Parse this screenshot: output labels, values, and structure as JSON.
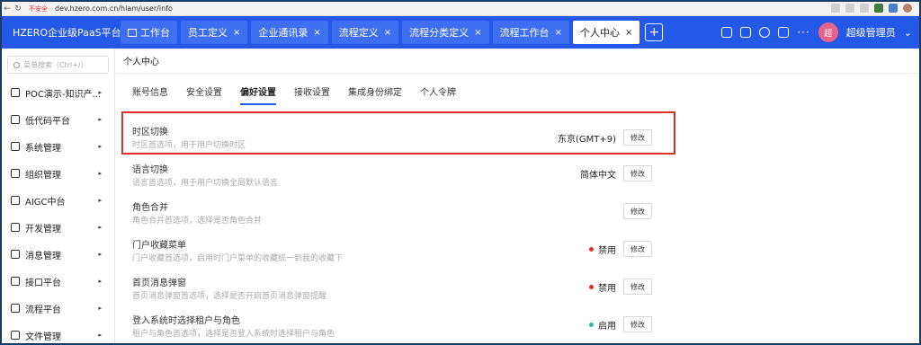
{
  "browser": {
    "secure_label": "不安全",
    "url": "dev.hzero.com.cn/hiam/user/info"
  },
  "app": {
    "brand": "HZERO企业级PaaS平台",
    "tabs": [
      {
        "label": "工作台",
        "closable": false
      },
      {
        "label": "员工定义",
        "closable": true
      },
      {
        "label": "企业通讯录",
        "closable": true
      },
      {
        "label": "流程定义",
        "closable": true
      },
      {
        "label": "流程分类定义",
        "closable": true
      },
      {
        "label": "流程工作台",
        "closable": true
      },
      {
        "label": "个人中心",
        "closable": true,
        "active": true
      }
    ],
    "close_glyph": "×",
    "add_glyph": "+",
    "more_glyph": "···",
    "avatar_text": "超",
    "user_name": "超级管理员",
    "user_chevron": "⌄"
  },
  "sidebar": {
    "search_placeholder": "菜单搜索（Ctrl+/）",
    "items": [
      {
        "label": "POC演示-知识产...",
        "icon": "doc-icon",
        "arrow": "▸"
      },
      {
        "label": "低代码平台",
        "icon": "grid-icon",
        "arrow": "▸"
      },
      {
        "label": "系统管理",
        "icon": "settings-icon",
        "arrow": "▸"
      },
      {
        "label": "组织管理",
        "icon": "org-icon",
        "arrow": "▸"
      },
      {
        "label": "AIGC中台",
        "icon": "ai-icon",
        "arrow": "▸"
      },
      {
        "label": "开发管理",
        "icon": "code-icon",
        "arrow": "▸"
      },
      {
        "label": "消息管理",
        "icon": "message-icon",
        "arrow": "▸"
      },
      {
        "label": "接口平台",
        "icon": "api-icon",
        "arrow": "▸"
      },
      {
        "label": "流程平台",
        "icon": "flow-icon",
        "arrow": "▸"
      },
      {
        "label": "文件管理",
        "icon": "folder-icon",
        "arrow": "▸"
      }
    ]
  },
  "main": {
    "page_title": "个人中心",
    "subtabs": [
      {
        "label": "账号信息",
        "active": false
      },
      {
        "label": "安全设置",
        "active": false
      },
      {
        "label": "偏好设置",
        "active": true
      },
      {
        "label": "接收设置",
        "active": false
      },
      {
        "label": "集成身份绑定",
        "active": false
      },
      {
        "label": "个人令牌",
        "active": false
      }
    ],
    "edit_label": "修改",
    "preferences": [
      {
        "title": "时区切换",
        "desc": "时区首选项，用于用户切换时区",
        "value": "东京(GMT+9)",
        "status_color": null,
        "highlighted": true
      },
      {
        "title": "语言切换",
        "desc": "语言首选项，用于用户切换全局默认语言",
        "value": "简体中文",
        "status_color": null
      },
      {
        "title": "角色合并",
        "desc": "角色合并首选项，选择是否角色合并",
        "value": "",
        "status_color": null
      },
      {
        "title": "门户收藏菜单",
        "desc": "门户收藏首选项，启用时门户菜单的收藏统一到我的收藏下",
        "value": "禁用",
        "status_color": "#e0302a"
      },
      {
        "title": "首页消息弹窗",
        "desc": "首页消息弹窗首选项，选择是否开启首页消息弹窗提醒",
        "value": "禁用",
        "status_color": "#e0302a"
      },
      {
        "title": "登入系统时选择租户与角色",
        "desc": "租户与角色首选项，选择是否登入系统时选择租户与角色",
        "value": "启用",
        "status_color": "#2bb8a4"
      }
    ]
  },
  "colors": {
    "brand_blue": "#2359e6",
    "highlight_red": "#e0302a"
  }
}
